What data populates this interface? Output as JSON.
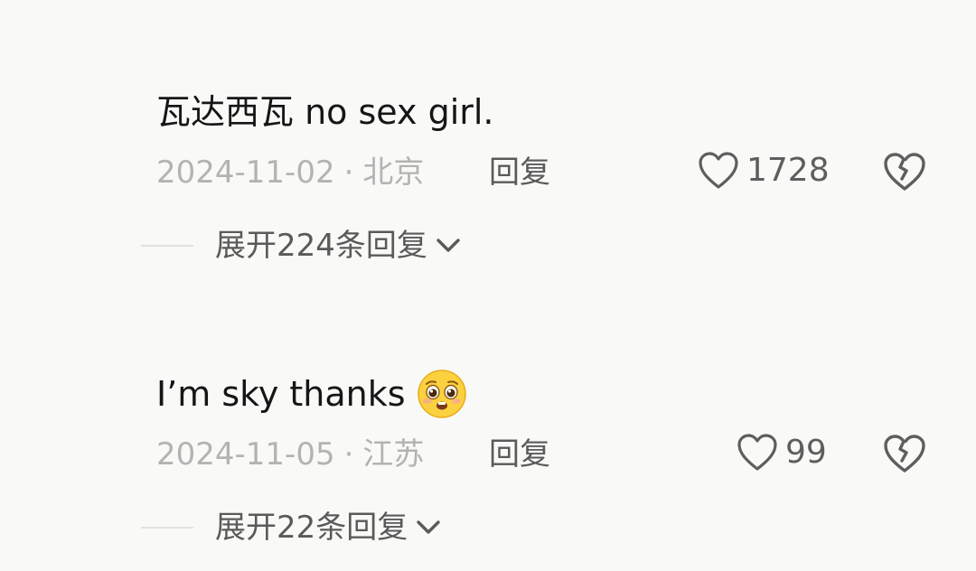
{
  "comments": [
    {
      "text": "瓦达西瓦 no sex girl.",
      "date": "2024-11-02",
      "location": "北京",
      "reply_label": "回复",
      "likes": "1728",
      "expand_label": "展开224条回复"
    },
    {
      "text": "I’m sky thanks",
      "emoji": "pleading-face-emoji",
      "date": "2024-11-05",
      "location": "江苏",
      "reply_label": "回复",
      "likes": "99",
      "expand_label": "展开22条回复"
    }
  ],
  "separator": "·",
  "icons": {
    "like": "heart-outline-icon",
    "dislike": "broken-heart-icon",
    "expand": "chevron-down-icon"
  },
  "colors": {
    "background": "#f9f9f7",
    "text": "#161616",
    "meta": "#b3b3b3",
    "action": "#5a5a5a"
  }
}
